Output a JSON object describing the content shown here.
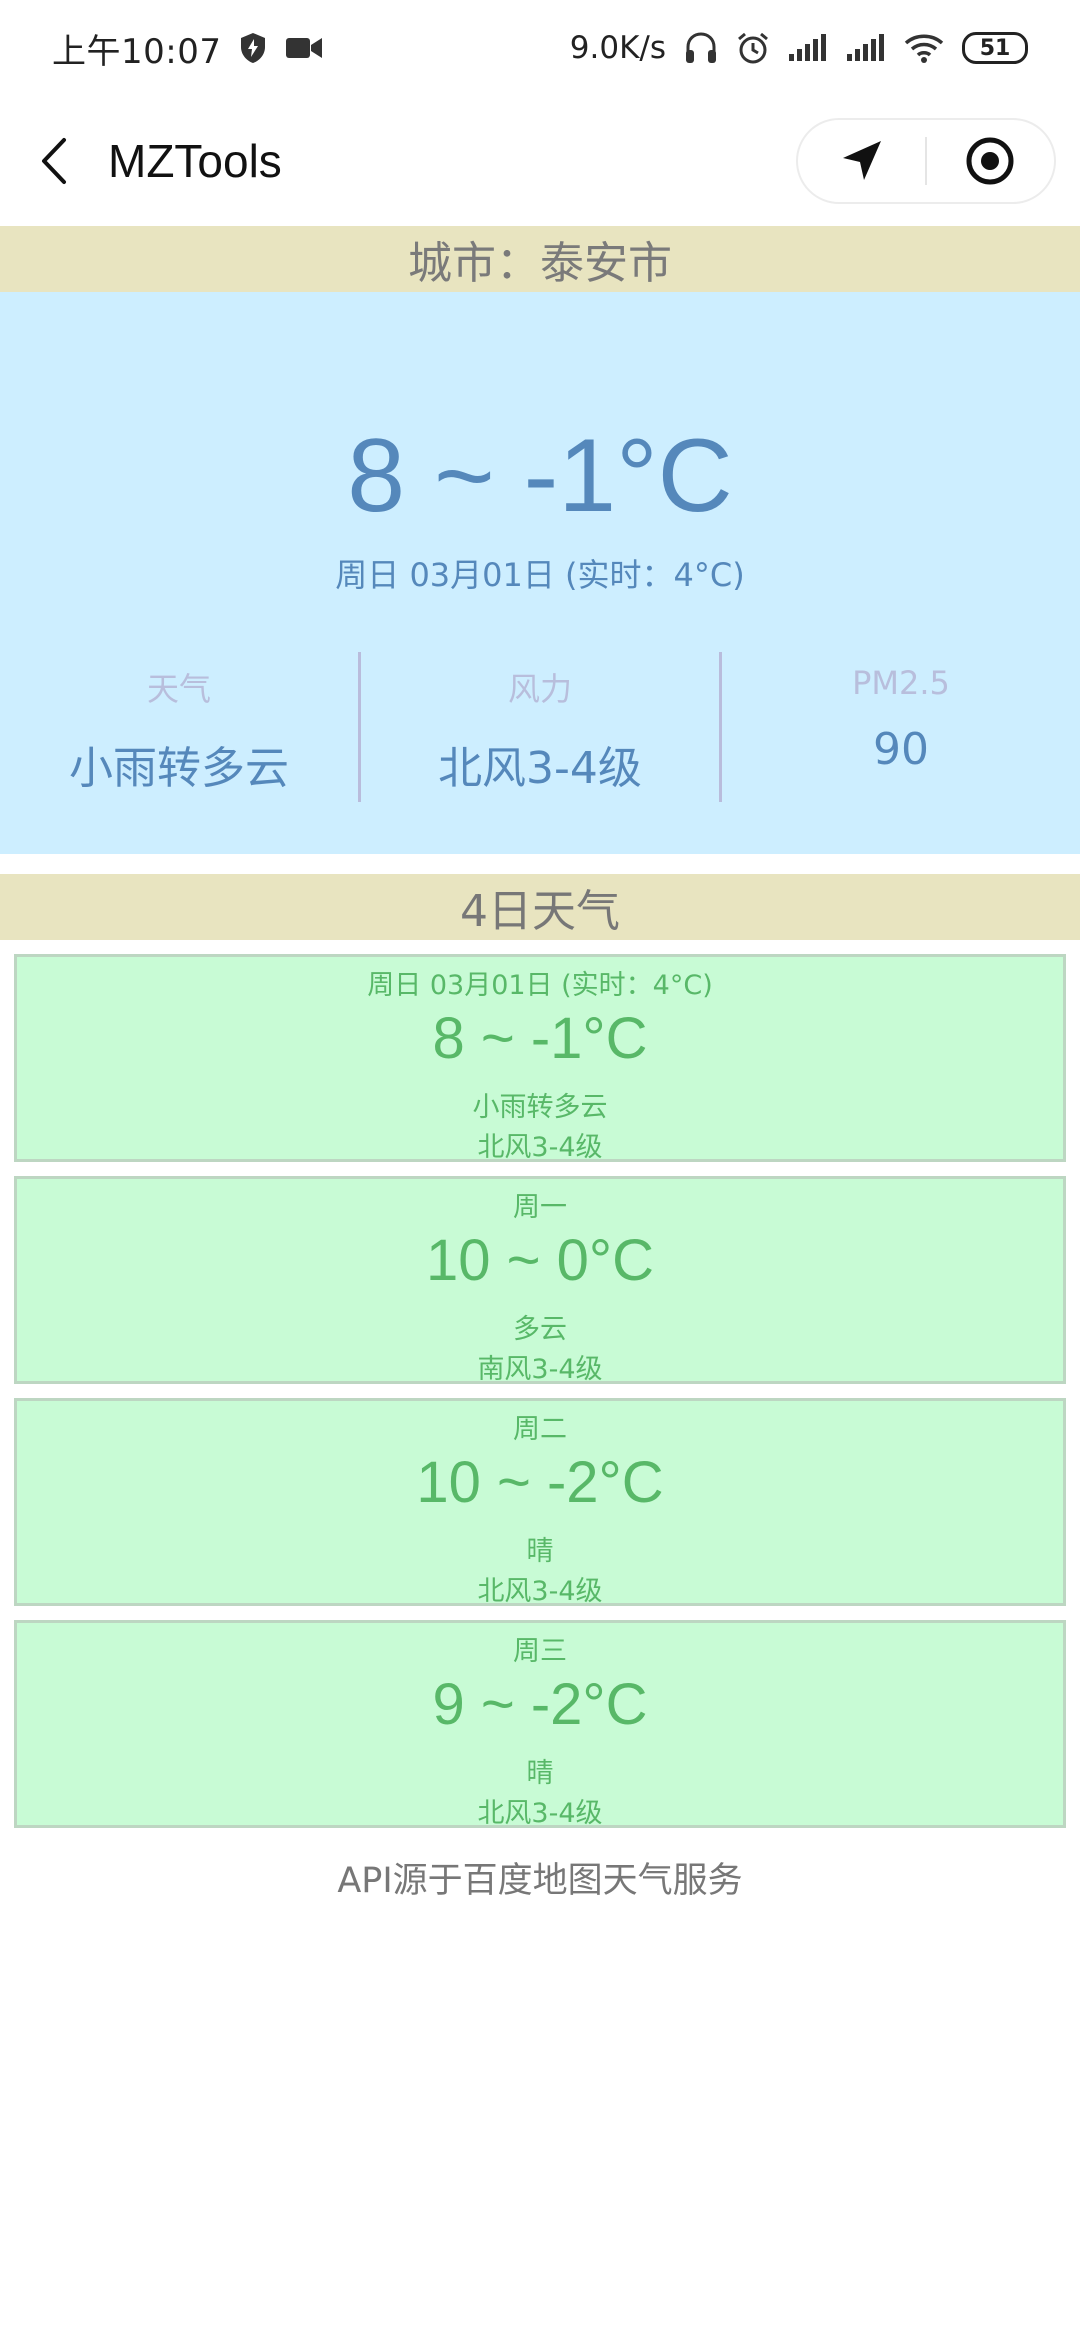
{
  "status_bar": {
    "time": "上午10:07",
    "net_speed": "9.0K/s",
    "battery": "51",
    "icons": [
      "shield-icon",
      "video-icon",
      "headphone-icon",
      "alarm-icon",
      "signal-icon",
      "signal-icon",
      "wifi-icon",
      "battery-icon"
    ]
  },
  "nav": {
    "title": "MZTools",
    "icons": [
      "back-arrow-icon",
      "location-arrow-icon",
      "record-target-icon"
    ]
  },
  "city": {
    "label": "城市：泰安市"
  },
  "today": {
    "temperature": "8 ~ -1°C",
    "date_line": "周日 03月01日 (实时：4°C)",
    "stats": [
      {
        "label": "天气",
        "value": "小雨转多云"
      },
      {
        "label": "风力",
        "value": "北风3-4级"
      },
      {
        "label": "PM2.5",
        "value": "90"
      }
    ]
  },
  "forecast": {
    "title": "4日天气",
    "days": [
      {
        "date": "周日 03月01日 (实时：4°C)",
        "temperature": "8 ~ -1°C",
        "weather": "小雨转多云",
        "wind": "北风3-4级"
      },
      {
        "date": "周一",
        "temperature": "10 ~ 0°C",
        "weather": "多云",
        "wind": "南风3-4级"
      },
      {
        "date": "周二",
        "temperature": "10 ~ -2°C",
        "weather": "晴",
        "wind": "北风3-4级"
      },
      {
        "date": "周三",
        "temperature": "9 ~ -2°C",
        "weather": "晴",
        "wind": "北风3-4级"
      }
    ]
  },
  "footer": {
    "note": "API源于百度地图天气服务"
  },
  "colors": {
    "city_bar_bg": "#e8e4c0",
    "main_panel_bg": "#cdeeff",
    "main_text": "#5588bb",
    "card_bg": "#c8fbd5",
    "card_text": "#58b868"
  }
}
